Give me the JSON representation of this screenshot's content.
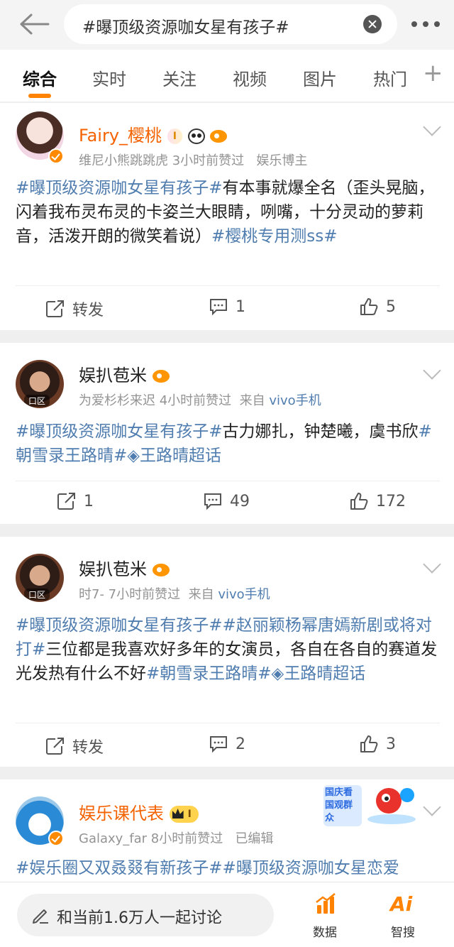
{
  "search": {
    "query": "#曝顶级资源咖女星有孩子#"
  },
  "tabs": [
    "综合",
    "实时",
    "关注",
    "视频",
    "图片",
    "热门"
  ],
  "posts": [
    {
      "username": "Fairy_樱桃",
      "badge": "I",
      "meta": "维尼小熊跳跳虎 3小时前赞过",
      "meta_extra": "娱乐博主",
      "body": [
        {
          "t": "#曝顶级资源咖女星有孩子#",
          "topic": true
        },
        {
          "t": "有本事就爆全名（歪头晃脑，闪着我布灵布灵的卡姿兰大眼睛，咧嘴，十分灵动的萝莉音，活泼开朗的微笑着说）",
          "topic": false
        },
        {
          "t": "#樱桃专用测ss#",
          "topic": true
        }
      ],
      "repost": "转发",
      "comments": "1",
      "likes": "5"
    },
    {
      "username": "娱扒苞米",
      "avatar_tag": "口区",
      "meta": "为爱杉杉来迟 4小时前赞过",
      "meta_from": "来自",
      "meta_device": "vivo手机",
      "body": [
        {
          "t": "#曝顶级资源咖女星有孩子#",
          "topic": true
        },
        {
          "t": "古力娜扎，钟楚曦，虞书欣",
          "topic": false
        },
        {
          "t": "#朝雪录王路晴#",
          "topic": true
        },
        {
          "t": "◈王路晴超话",
          "topic": true
        }
      ],
      "repost": "1",
      "comments": "49",
      "likes": "172"
    },
    {
      "username": "娱扒苞米",
      "avatar_tag": "口区",
      "meta": "时7- 7小时前赞过",
      "meta_from": "来自",
      "meta_device": "vivo手机",
      "body": [
        {
          "t": "#曝顶级资源咖女星有孩子##赵丽颖杨幂唐嫣新剧或将对打#",
          "topic": true
        },
        {
          "t": "三位都是我喜欢好多年的女演员，各自在各自的赛道发光发热有什么不好",
          "topic": false
        },
        {
          "t": "#朝雪录王路晴#",
          "topic": true
        },
        {
          "t": "◈王路晴超话",
          "topic": true
        }
      ],
      "repost": "转发",
      "comments": "2",
      "likes": "3"
    },
    {
      "username": "娱乐课代表",
      "badge": "I",
      "meta": "Galaxy_far 8小时前赞过",
      "meta_extra": "已编辑",
      "promo": "国庆看国观群众",
      "body": [
        {
          "t": "#娱乐圈又双叒叕有新孩子##曝顶级资源咖女星恋爱",
          "topic": true
        }
      ]
    }
  ],
  "bottom": {
    "discuss_label": "和当前1.6万人一起讨论",
    "data_label": "数据",
    "ai_label": "智搜",
    "ai_glyph": "Ai"
  },
  "colors": {
    "accent": "#ff8200",
    "topic": "#507daf",
    "vip_name": "#f46200"
  }
}
